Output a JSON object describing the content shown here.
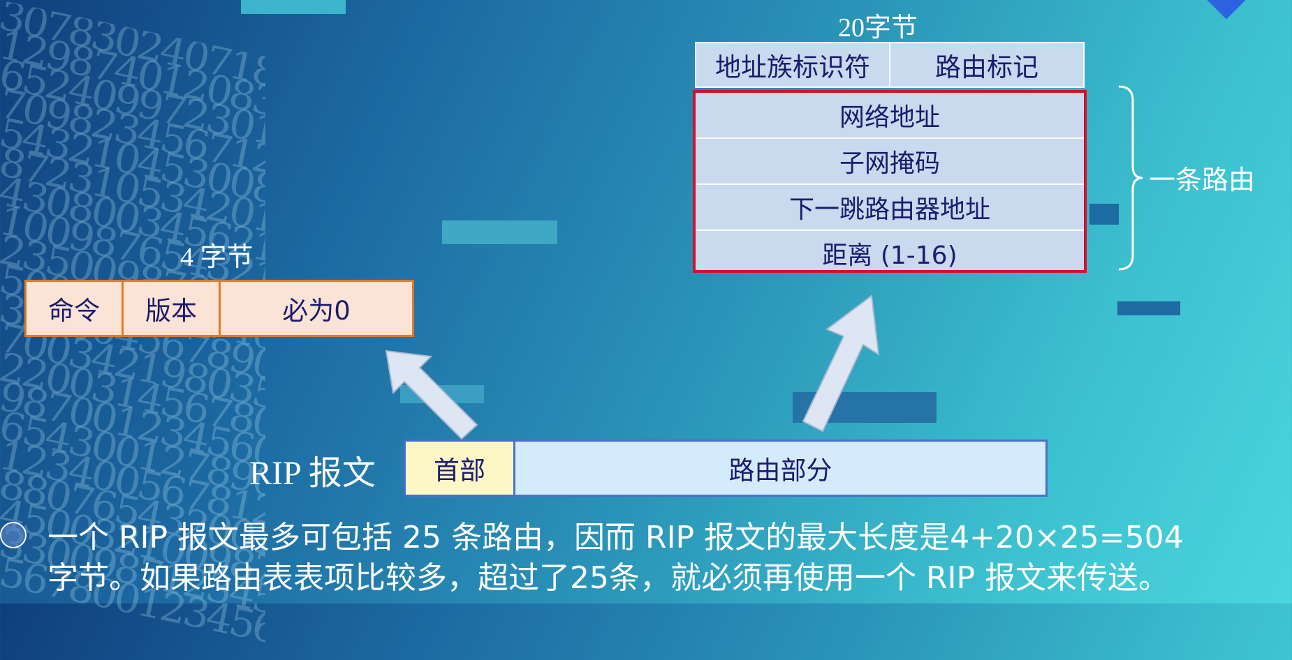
{
  "header": {
    "size_label": "4 字节",
    "fields": [
      "命令",
      "版本",
      "必为0"
    ]
  },
  "route_entry": {
    "size_label": "20字节",
    "top_fields": [
      "地址族标识符",
      "路由标记"
    ],
    "fields": [
      "网络地址",
      "子网掩码",
      "下一跳路由器地址",
      "距离 (1-16)"
    ],
    "brace_label": "一条路由"
  },
  "rip_message": {
    "label": "RIP 报文",
    "header": "首部",
    "route_part": "路由部分"
  },
  "footnote": {
    "line1": "一个 RIP 报文最多可包括 25 条路由，因而 RIP 报文的最大长度是4+20×25=504",
    "line2": "字节。如果路由表表项比较多，超过了25条，就必须再使用一个 RIP 报文来传送。"
  },
  "colors": {
    "header_fill": "#fbe4d6",
    "header_border": "#e07a2a",
    "route_fill": "#c9d9ee",
    "route_highlight": "#d4102a",
    "rip_header_fill": "#fdf7c6",
    "rip_route_fill": "#d3ebfb"
  },
  "icons": {
    "badge": "presentation-icon"
  }
}
